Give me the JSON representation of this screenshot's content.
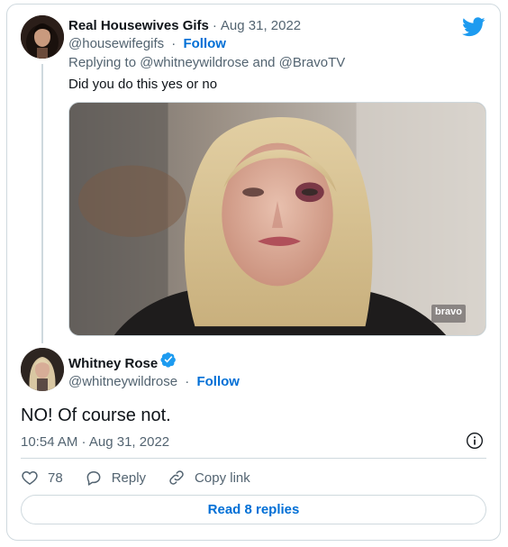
{
  "parent_tweet": {
    "display_name": "Real Housewives Gifs",
    "date": "Aug 31, 2022",
    "handle": "@housewifegifs",
    "follow_label": "Follow",
    "replying_to": "Replying to @whitneywildrose and @BravoTV",
    "text": "Did you do this yes or no",
    "media_watermark": "bravo"
  },
  "main_tweet": {
    "display_name": "Whitney Rose",
    "handle": "@whitneywildrose",
    "follow_label": "Follow",
    "verified": true,
    "text": "NO! Of course not.",
    "timestamp": "10:54 AM · Aug 31, 2022"
  },
  "actions": {
    "like_count": "78",
    "reply_label": "Reply",
    "copy_link_label": "Copy link"
  },
  "read_replies_label": "Read 8 replies",
  "icons": {
    "brand": "twitter-bird-icon",
    "verified": "verified-badge-icon",
    "info": "info-icon",
    "like": "heart-icon",
    "reply": "reply-bubble-icon",
    "copy": "link-icon"
  },
  "colors": {
    "link_blue": "#006fd6",
    "twitter_blue": "#1d9bf0",
    "muted_text": "#536471",
    "border": "#cfd9de"
  }
}
